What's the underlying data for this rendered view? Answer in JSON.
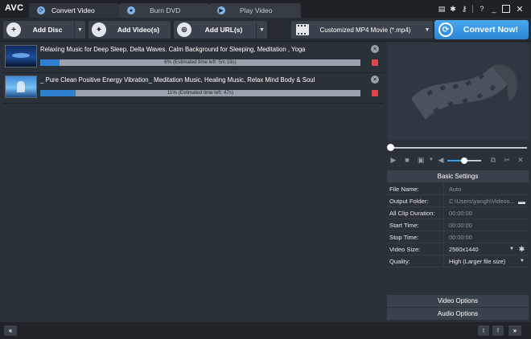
{
  "app": {
    "logo": "AVC"
  },
  "tabs": [
    {
      "label": "Convert Video",
      "icon": "refresh-icon",
      "active": true
    },
    {
      "label": "Burn DVD",
      "icon": "disc-icon",
      "active": false
    },
    {
      "label": "Play Video",
      "icon": "play-icon",
      "active": false
    }
  ],
  "toolbar": {
    "add_disc": "Add Disc",
    "add_videos": "Add Video(s)",
    "add_urls": "Add URL(s)",
    "format": "Customized MP4 Movie (*.mp4)",
    "convert": "Convert Now!"
  },
  "files": [
    {
      "name": "Relaxing Music for Deep Sleep. Delta Waves. Calm Background for Sleeping, Meditation , Yoga",
      "progress": 6,
      "progress_text": "6% (Estimated time left: 5m 19s)"
    },
    {
      "name": "_ Pure Clean Positive Energy Vibration_ Meditation Music, Healing Music, Relax Mind Body & Soul",
      "progress": 11,
      "progress_text": "11% (Estimated time left: 47s)"
    }
  ],
  "player": {
    "seek": 0,
    "volume": 0.5
  },
  "settings": {
    "title": "Basic Settings",
    "rows": [
      {
        "key": "File Name:",
        "value": "Auto"
      },
      {
        "key": "Output Folder:",
        "value": "C:\\Users\\yangh\\Videos..."
      },
      {
        "key": "All Clip Duration:",
        "value": "00:00:00"
      },
      {
        "key": "Start Time:",
        "value": "00:00:00"
      },
      {
        "key": "Stop Time:",
        "value": "00:00:00"
      },
      {
        "key": "Video Size:",
        "value": "2560x1440"
      },
      {
        "key": "Quality:",
        "value": "High (Larger file size)"
      }
    ],
    "video_options": "Video Options",
    "audio_options": "Audio Options"
  },
  "statusbar": {
    "collapse": "«",
    "expand": "»",
    "twitter": "t",
    "facebook": "f"
  }
}
